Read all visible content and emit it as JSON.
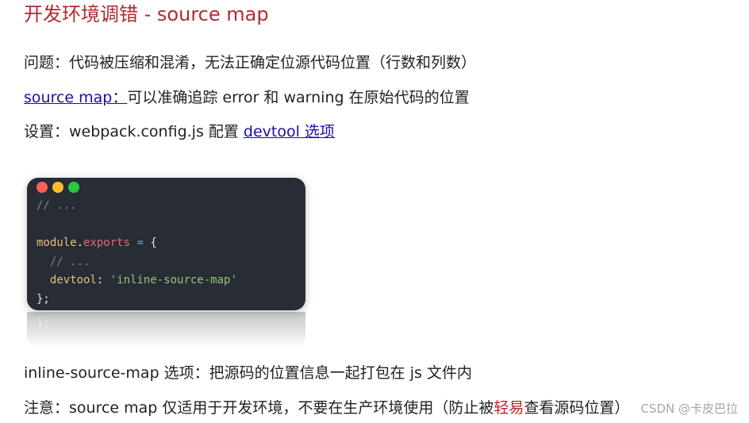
{
  "title": "开发环境调错 - source map",
  "problem": "问题：代码被压缩和混淆，无法正确定位源代码位置（行数和列数）",
  "sourcemap_line": {
    "link": "source map：",
    "rest": "可以准确追踪 error 和 warning 在原始代码的位置"
  },
  "settings_line": {
    "prefix": "设置：webpack.config.js 配置 ",
    "link": "devtool 选项"
  },
  "code": {
    "comment1": "// ...",
    "module": "module",
    "dot": ".",
    "exports": "exports",
    "eq": " = ",
    "open": "{",
    "comment2": "// ...",
    "devtool_key": "devtool",
    "colon": ": ",
    "devtool_val": "'inline-source-map'",
    "close": "};"
  },
  "reflection": {
    "line1": "};",
    "line2": "devtool: 'inline-source-map'"
  },
  "inline_note": "inline-source-map 选项：把源码的位置信息一起打包在 js 文件内",
  "caution_line": {
    "before": "注意：source map 仅适用于开发环境，不要在生产环境使用（防止被",
    "highlight": "轻易",
    "after": "查看源码位置）"
  },
  "watermark": "CSDN @卡皮巴拉",
  "colors": {
    "title": "#b02a30",
    "link": "#1a0dab",
    "highlight": "#c0242c",
    "code_bg": "#282c34"
  }
}
